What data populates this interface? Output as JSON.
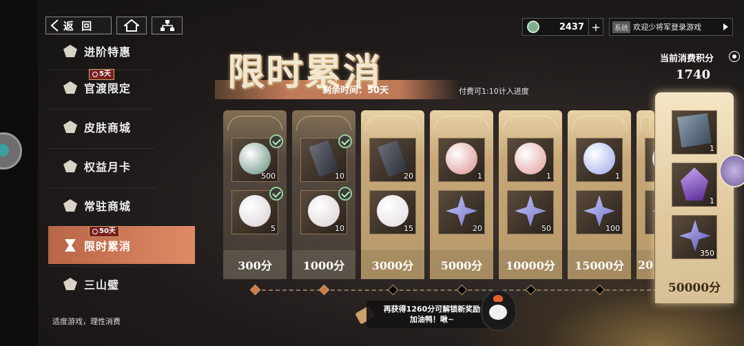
{
  "nav": {
    "back_label": "返 回"
  },
  "resource": {
    "value": "2437",
    "plus": "+",
    "icon": "jade-coin-icon"
  },
  "system": {
    "tag": "系统",
    "message": "欢迎少将军登录游戏"
  },
  "sidebar": {
    "items": [
      {
        "label": "进阶特惠",
        "icon": "crown-icon"
      },
      {
        "label": "官渡限定",
        "icon": "emblem-icon",
        "timer": "5天"
      },
      {
        "label": "皮肤商城",
        "icon": "mask-icon"
      },
      {
        "label": "权益月卡",
        "icon": "cards-icon"
      },
      {
        "label": "常驻商城",
        "icon": "shop-icon"
      },
      {
        "label": "限时累消",
        "icon": "hourglass-icon",
        "timer": "50天",
        "active": true
      },
      {
        "label": "三山璧",
        "icon": "jade-disc-icon"
      }
    ],
    "foot_note": "适度游戏，理性消费"
  },
  "event": {
    "title": "限时累消",
    "remaining": "剩余时间：50天",
    "paid_note": "付费可1:10计入进度"
  },
  "score": {
    "label": "当前消费积分",
    "value": "1740"
  },
  "tiers": [
    {
      "points": "300分",
      "claimed": true,
      "items": [
        {
          "name": "jade-coin",
          "qty": "500",
          "color": "#5f8a78"
        },
        {
          "name": "pearl-orb",
          "qty": "5",
          "color": "#d9d0d4"
        }
      ]
    },
    {
      "points": "1000分",
      "claimed": true,
      "items": [
        {
          "name": "dark-token",
          "qty": "10",
          "color": "#2e3038"
        },
        {
          "name": "pearl-orb",
          "qty": "10",
          "color": "#d9d0d4"
        }
      ]
    },
    {
      "points": "3000分",
      "claimed": false,
      "items": [
        {
          "name": "dark-token",
          "qty": "20",
          "color": "#2e3038"
        },
        {
          "name": "pearl-orb",
          "qty": "15",
          "color": "#e2dae0"
        }
      ]
    },
    {
      "points": "5000分",
      "claimed": false,
      "items": [
        {
          "name": "lucky-bag",
          "qty": "1",
          "color": "#d98c8c"
        },
        {
          "name": "star-crystal",
          "qty": "20",
          "color": "#7a74c8"
        }
      ]
    },
    {
      "points": "10000分",
      "claimed": false,
      "items": [
        {
          "name": "lucky-bag",
          "qty": "1",
          "color": "#e09a9a"
        },
        {
          "name": "star-crystal",
          "qty": "50",
          "color": "#7a74c8"
        }
      ]
    },
    {
      "points": "15000分",
      "claimed": false,
      "items": [
        {
          "name": "crystal-gem",
          "qty": "1",
          "color": "#9aa8e8"
        },
        {
          "name": "star-crystal",
          "qty": "100",
          "color": "#7a74c8"
        }
      ]
    },
    {
      "points": "20",
      "claimed": false,
      "items": [
        {
          "name": "crystal-gem",
          "qty": "",
          "color": "#9aa8e8"
        },
        {
          "name": "star-crystal",
          "qty": "",
          "color": "#7a74c8"
        }
      ]
    }
  ],
  "grand": {
    "points": "50000分",
    "items": [
      {
        "name": "scroll-card",
        "qty": "1",
        "color": "#7a8a9a"
      },
      {
        "name": "violet-crystal",
        "qty": "1",
        "color": "#8a5ac8"
      },
      {
        "name": "star-crystal",
        "qty": "350",
        "color": "#7a74c8"
      }
    ]
  },
  "bubble": {
    "line1": "再获得1260分可解锁新奖励",
    "line2": "加油鸭！啾~"
  }
}
